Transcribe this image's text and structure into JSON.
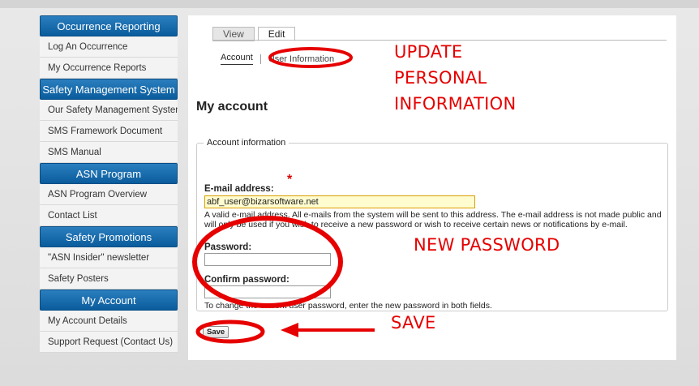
{
  "sidebar": {
    "sections": [
      {
        "header": "Occurrence Reporting",
        "items": [
          "Log An Occurrence",
          "My Occurrence Reports"
        ]
      },
      {
        "header": "Safety Management System",
        "items": [
          "Our Safety Management System",
          "SMS Framework Document",
          "SMS Manual"
        ]
      },
      {
        "header": "ASN Program",
        "items": [
          "ASN Program Overview",
          "Contact List"
        ]
      },
      {
        "header": "Safety Promotions",
        "items": [
          "\"ASN Insider\" newsletter",
          "Safety Posters"
        ]
      },
      {
        "header": "My Account",
        "items": [
          "My Account Details",
          "Support Request (Contact Us)"
        ]
      }
    ]
  },
  "tabs": {
    "view": "View",
    "edit": "Edit"
  },
  "subtabs": {
    "account": "Account",
    "user_info": "User Information"
  },
  "page_title": "My account",
  "form": {
    "legend": "Account information",
    "email_label": "E-mail address:",
    "required_mark": "*",
    "email_value": "abf_user@bizarsoftware.net",
    "email_desc": "A valid e-mail address. All e-mails from the system will be sent to this address. The e-mail address is not made public and will only be used if you wish to receive a new password or wish to receive certain news or notifications by e-mail.",
    "password_label": "Password:",
    "confirm_label": "Confirm password:",
    "password_desc": "To change the current user password, enter the new password in both fields.",
    "save_label": "Save"
  },
  "annotations": {
    "update": "UPDATE",
    "personal": "PERSONAL",
    "information": "INFORMATION",
    "new_password": "NEW PASSWORD",
    "save": "SAVE",
    "color": "#e60000"
  }
}
